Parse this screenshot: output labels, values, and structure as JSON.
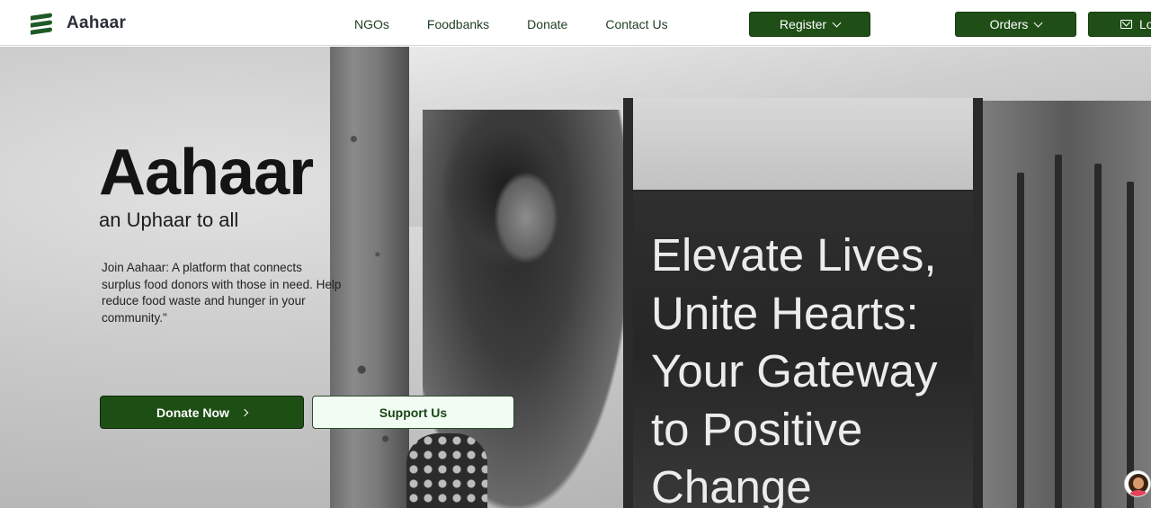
{
  "header": {
    "brand": "Aahaar",
    "nav": [
      "NGOs",
      "Foodbanks",
      "Donate",
      "Contact Us"
    ],
    "register_label": "Register",
    "orders_label": "Orders",
    "login_label": "Lo"
  },
  "hero": {
    "title": "Aahaar",
    "subtitle": "an Uphaar to all",
    "description": "Join Aahaar: A platform that connects surplus food donors with those in need. Help reduce food waste and hunger in your community.\"",
    "donate_label": "Donate Now",
    "support_label": "Support Us",
    "tagline": "Elevate Lives, Unite Hearts: Your Gateway to Positive Change"
  },
  "colors": {
    "brand_green": "#1f4f17",
    "support_bg": "#f1fdf3"
  },
  "icons": {
    "logo": "logo-icon",
    "dropdown": "chevron-down-icon",
    "mail": "mail-icon",
    "arrow": "chevron-right-icon",
    "chat_avatar": "avatar-icon"
  }
}
